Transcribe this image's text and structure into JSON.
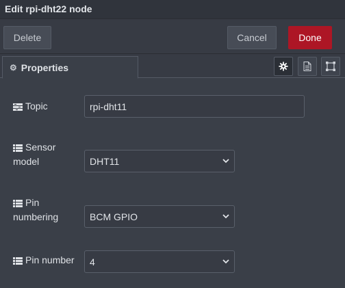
{
  "title": "Edit rpi-dht22 node",
  "toolbar": {
    "delete_label": "Delete",
    "cancel_label": "Cancel",
    "done_label": "Done"
  },
  "tabs": {
    "properties_label": "Properties"
  },
  "form": {
    "topic": {
      "label": "Topic",
      "value": "rpi-dht11"
    },
    "sensor_model": {
      "label_line1": "Sensor",
      "label_line2": "model",
      "value": "DHT11"
    },
    "pin_numbering": {
      "label_line1": "Pin",
      "label_line2": "numbering",
      "value": "BCM GPIO"
    },
    "pin_number": {
      "label": "Pin number",
      "value": "4"
    }
  },
  "colors": {
    "done_button": "#ad1625",
    "panel_background": "#3a3f48"
  }
}
